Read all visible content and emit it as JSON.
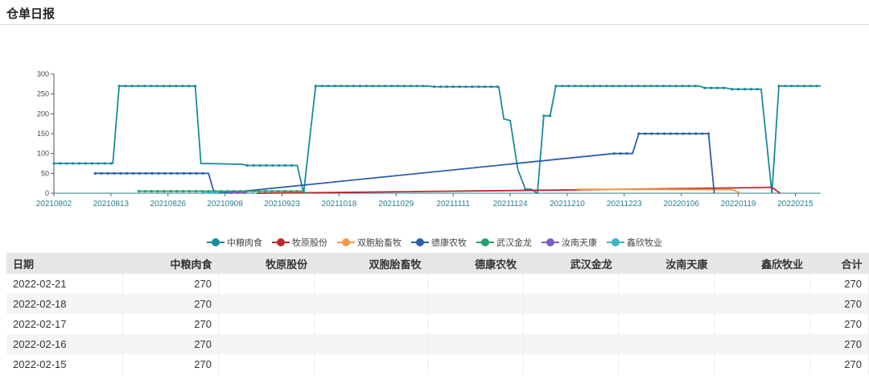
{
  "header": {
    "title": "仓单日报"
  },
  "chart_data": {
    "type": "line",
    "title": "",
    "xlabel": "",
    "ylabel": "",
    "ylim": [
      0,
      300
    ],
    "yticks": [
      0,
      50,
      100,
      150,
      200,
      250,
      300
    ],
    "xlim": [
      0,
      121
    ],
    "xticks": [
      {
        "i": 0,
        "label": "20210802"
      },
      {
        "i": 9,
        "label": "20210813"
      },
      {
        "i": 18,
        "label": "20210826"
      },
      {
        "i": 27,
        "label": "20210908"
      },
      {
        "i": 36,
        "label": "20210923"
      },
      {
        "i": 45,
        "label": "20211018"
      },
      {
        "i": 54,
        "label": "20211029"
      },
      {
        "i": 63,
        "label": "20211111"
      },
      {
        "i": 72,
        "label": "20211124"
      },
      {
        "i": 81,
        "label": "20211210"
      },
      {
        "i": 90,
        "label": "20211223"
      },
      {
        "i": 99,
        "label": "20220106"
      },
      {
        "i": 108,
        "label": "20220119"
      },
      {
        "i": 117,
        "label": "20220215"
      }
    ],
    "legend_position": "bottom",
    "series": [
      {
        "name": "中粮肉食",
        "color": "#1a8a9c",
        "points": [
          [
            0,
            75
          ],
          [
            9.3,
            75
          ],
          [
            10.3,
            270
          ],
          [
            22.3,
            270
          ],
          [
            23.2,
            75
          ],
          [
            29.7,
            73
          ],
          [
            30.5,
            70
          ],
          [
            38.4,
            70
          ],
          [
            39.4,
            0
          ],
          [
            41.3,
            270
          ],
          [
            59,
            270
          ],
          [
            60,
            268
          ],
          [
            70.2,
            268
          ],
          [
            71,
            187
          ],
          [
            72,
            183
          ],
          [
            73.2,
            60
          ],
          [
            74.4,
            10
          ],
          [
            75.3,
            10
          ],
          [
            76.3,
            0
          ],
          [
            77.3,
            195
          ],
          [
            78.3,
            195
          ],
          [
            79.2,
            270
          ],
          [
            101.8,
            270
          ],
          [
            102.7,
            265
          ],
          [
            106,
            265
          ],
          [
            107,
            262
          ],
          [
            111.6,
            262
          ],
          [
            113.3,
            0
          ],
          [
            114.4,
            270
          ],
          [
            121,
            270
          ]
        ]
      },
      {
        "name": "牧原股份",
        "color": "#c0282a",
        "points": [
          [
            32,
            0
          ],
          [
            80,
            8
          ],
          [
            110,
            14
          ],
          [
            113.3,
            15
          ],
          [
            114.6,
            0
          ]
        ]
      },
      {
        "name": "双胞胎畜牧",
        "color": "#f59a4a",
        "points": [
          [
            82.6,
            10
          ],
          [
            107,
            9
          ],
          [
            108.4,
            0
          ]
        ]
      },
      {
        "name": "德康农牧",
        "color": "#2b5fa8",
        "points": [
          [
            6.5,
            50
          ],
          [
            24.4,
            50
          ],
          [
            25.3,
            0
          ],
          [
            28,
            2
          ],
          [
            88.4,
            100
          ],
          [
            91.3,
            100
          ],
          [
            92.3,
            150
          ],
          [
            103.3,
            150
          ],
          [
            104.2,
            0
          ]
        ]
      },
      {
        "name": "武汉金龙",
        "color": "#22a06b",
        "points": [
          [
            13.4,
            5
          ],
          [
            39.3,
            5
          ],
          [
            40,
            0
          ]
        ]
      },
      {
        "name": "汝南天康",
        "color": "#7b5cc4",
        "points": [
          [
            28,
            1
          ],
          [
            30.5,
            1
          ]
        ]
      },
      {
        "name": "鑫欣牧业",
        "color": "#3bb3c3",
        "points": [
          [
            23.5,
            1
          ],
          [
            26,
            1
          ]
        ]
      }
    ]
  },
  "table": {
    "headers": [
      "日期",
      "中粮肉食",
      "牧原股份",
      "双胞胎畜牧",
      "德康农牧",
      "武汉金龙",
      "汝南天康",
      "鑫欣牧业",
      "合计"
    ],
    "rows": [
      [
        "2022-02-21",
        "270",
        "",
        "",
        "",
        "",
        "",
        "",
        "270"
      ],
      [
        "2022-02-18",
        "270",
        "",
        "",
        "",
        "",
        "",
        "",
        "270"
      ],
      [
        "2022-02-17",
        "270",
        "",
        "",
        "",
        "",
        "",
        "",
        "270"
      ],
      [
        "2022-02-16",
        "270",
        "",
        "",
        "",
        "",
        "",
        "",
        "270"
      ],
      [
        "2022-02-15",
        "270",
        "",
        "",
        "",
        "",
        "",
        "",
        "270"
      ]
    ]
  }
}
